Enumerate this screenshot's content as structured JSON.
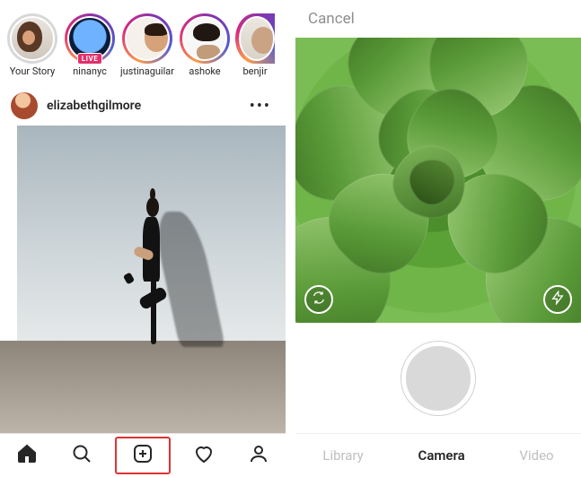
{
  "stories": [
    {
      "label": "Your Story",
      "live": false
    },
    {
      "label": "ninanyc",
      "live": true,
      "live_text": "LIVE"
    },
    {
      "label": "justinaguilar",
      "live": false
    },
    {
      "label": "ashoke",
      "live": false
    },
    {
      "label": "benjir",
      "live": false
    }
  ],
  "post": {
    "username": "elizabethgilmore",
    "more": "•••"
  },
  "nav": {
    "home": "home-icon",
    "search": "search-icon",
    "create": "create-icon",
    "activity": "heart-icon",
    "profile": "profile-icon"
  },
  "camera": {
    "cancel": "Cancel",
    "switch_icon": "switch-camera-icon",
    "flash_icon": "flash-icon",
    "tabs": [
      {
        "label": "Library",
        "active": false
      },
      {
        "label": "Camera",
        "active": true
      },
      {
        "label": "Video",
        "active": false
      }
    ]
  }
}
